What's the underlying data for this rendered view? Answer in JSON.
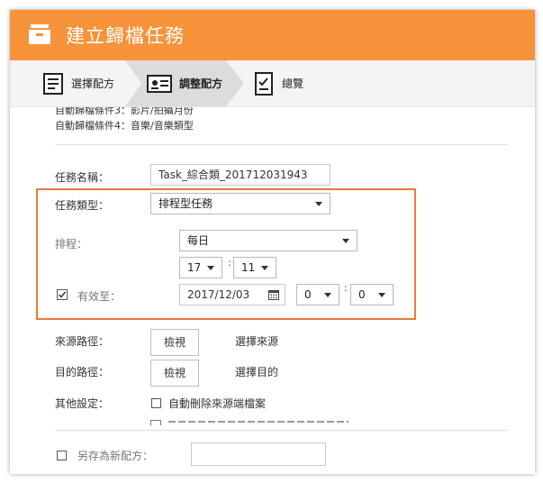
{
  "header": {
    "title": "建立歸檔任務",
    "icon": "archive-box-icon",
    "color": "#f7933a"
  },
  "steps": [
    {
      "label": "選擇配方",
      "icon": "list-icon"
    },
    {
      "label": "調整配方",
      "icon": "settings-card-icon"
    },
    {
      "label": "總覽",
      "icon": "checklist-icon"
    }
  ],
  "conditions": {
    "line3": "自動歸檔條件3：影片/拍攝月份",
    "line4": "自動歸檔條件4：音樂/音樂類型"
  },
  "form": {
    "task_name_label": "任務名稱：",
    "task_name_value": "Task_綜合類_201712031943",
    "task_type_label": "任務類型：",
    "task_type_value": "排程型任務",
    "schedule_label": "排程：",
    "schedule_value": "每日",
    "hour_value": "17",
    "minute_value": "11",
    "valid_until_label": "有效至：",
    "valid_date_value": "2017/12/03",
    "valid_hour_value": "0",
    "valid_minute_value": "0",
    "colon": ":",
    "source_label": "來源路徑：",
    "source_button": "檢視",
    "source_hint": "選擇來源",
    "dest_label": "目的路徑：",
    "dest_button": "檢視",
    "dest_hint": "選擇目的",
    "other_label": "其他設定：",
    "auto_delete_label": "自動刪除來源端檔案"
  },
  "bottom": {
    "save_as_label": "另存為新配方："
  },
  "accent": "#e97a3a"
}
